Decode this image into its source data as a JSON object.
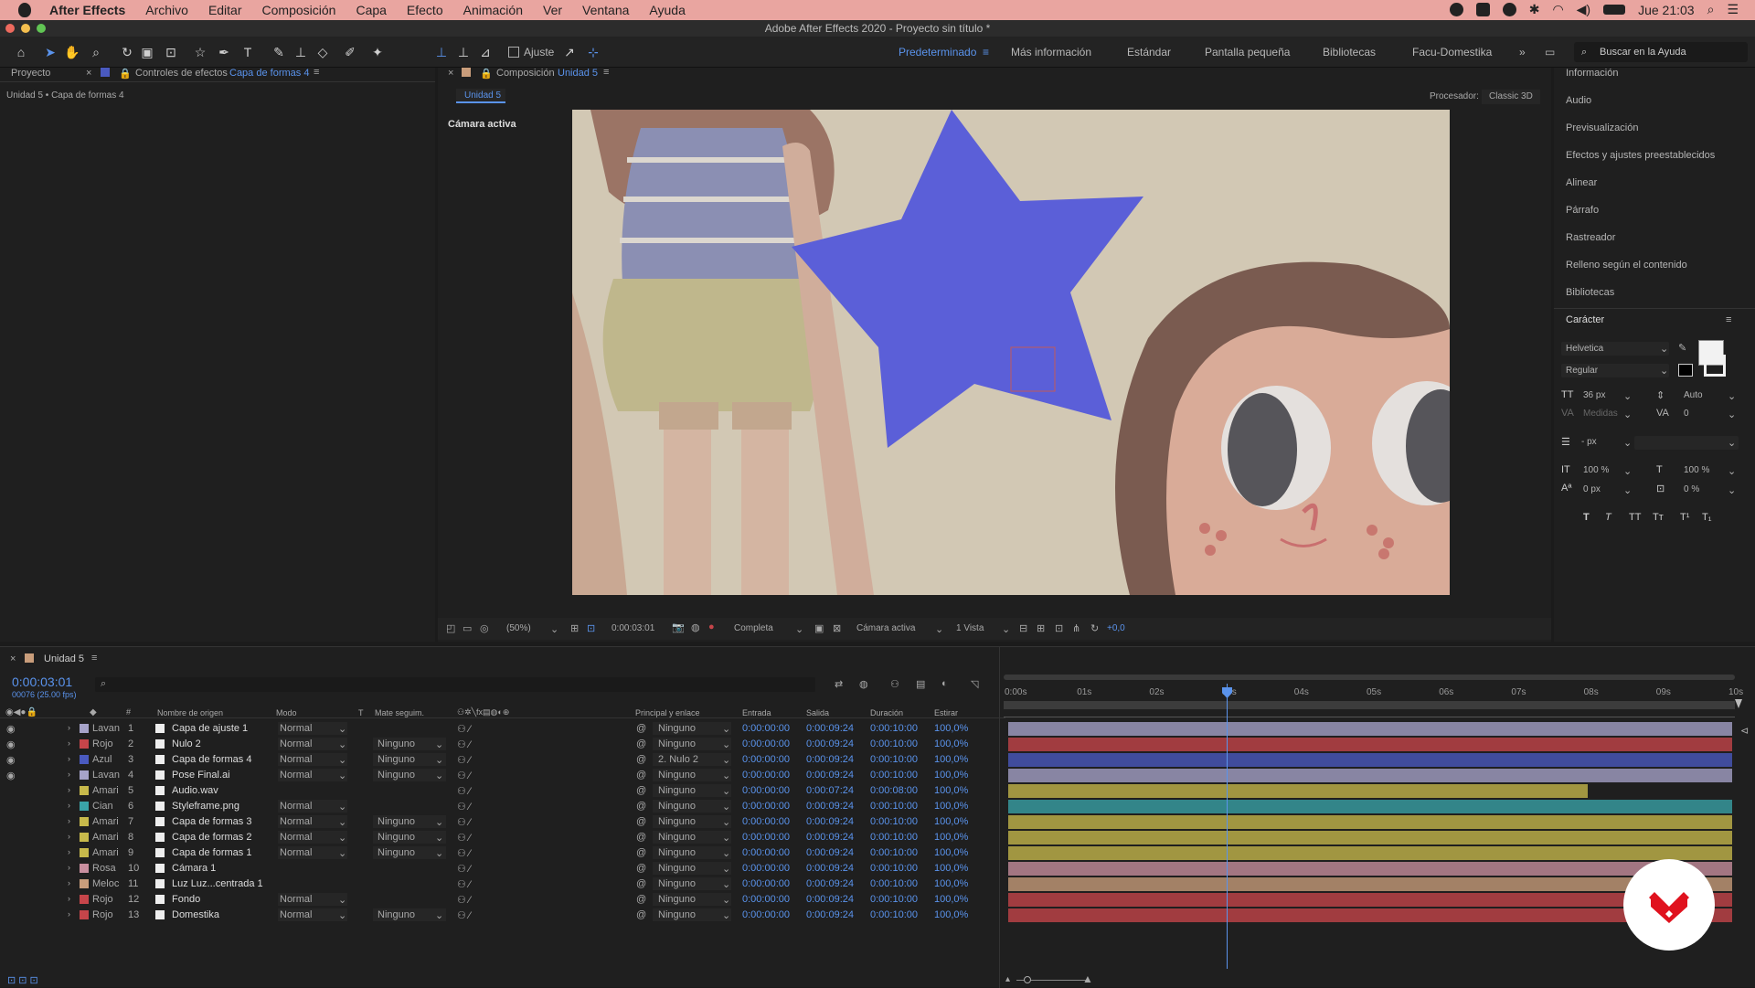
{
  "menubar": {
    "app": "After Effects",
    "items": [
      "Archivo",
      "Editar",
      "Composición",
      "Capa",
      "Efecto",
      "Animación",
      "Ver",
      "Ventana",
      "Ayuda"
    ],
    "clock": "Jue 21:03"
  },
  "window_title": "Adobe After Effects 2020 - Proyecto sin título *",
  "toolbar": {
    "snap": "Ajuste",
    "workspaces": [
      "Predeterminado",
      "Más información",
      "Estándar",
      "Pantalla pequeña",
      "Bibliotecas",
      "Facu-Domestika"
    ],
    "search": "Buscar en la Ayuda"
  },
  "project_panel": {
    "tab_project": "Proyecto",
    "tab_effects": "Controles de efectos",
    "tab_effects_layer": "Capa de formas 4",
    "breadcrumb": "Unidad 5 • Capa de formas 4"
  },
  "comp_panel": {
    "tab": "Composición",
    "tab_comp": "Unidad 5",
    "sub_tab": "Unidad 5",
    "renderer_label": "Procesador:",
    "renderer": "Classic 3D",
    "view_label": "Cámara activa",
    "footer": {
      "zoom": "(50%)",
      "time": "0:00:03:01",
      "quality": "Completa",
      "camera": "Cámara activa",
      "views": "1 Vista",
      "offset": "+0,0"
    }
  },
  "right_panel": {
    "items": [
      "Información",
      "Audio",
      "Previsualización",
      "Efectos y ajustes preestablecidos",
      "Alinear",
      "Párrafo",
      "Rastreador",
      "Relleno según el contenido",
      "Bibliotecas"
    ],
    "character": {
      "title": "Carácter",
      "font": "Helvetica",
      "style": "Regular",
      "size": "36 px",
      "leading": "Auto",
      "kerning": "Medidas",
      "tracking": "0",
      "stroke": "- px",
      "v_scale": "100 %",
      "h_scale": "100 %",
      "baseline": "0 px",
      "tsume": "0 %"
    }
  },
  "timeline": {
    "tab": "Unidad 5",
    "current_time": "0:00:03:01",
    "frame_info": "00076 (25.00 fps)",
    "headers": {
      "source": "Nombre de origen",
      "mode": "Modo",
      "t": "T",
      "matte": "Mate seguim.",
      "parent": "Principal y enlace",
      "in": "Entrada",
      "out": "Salida",
      "duration": "Duración",
      "stretch": "Estirar"
    },
    "ruler": [
      "0:00s",
      "01s",
      "02s",
      "03s",
      "04s",
      "05s",
      "06s",
      "07s",
      "08s",
      "09s",
      "10s"
    ],
    "layers": [
      {
        "label": "Lavan",
        "color": "#a6a3c9",
        "num": "1",
        "name": "Capa de ajuste 1",
        "mode": "Normal",
        "matte": "",
        "parent": "Ninguno",
        "in": "0:00:00:00",
        "out": "0:00:09:24",
        "dur": "0:00:10:00",
        "str": "100,0%"
      },
      {
        "label": "Rojo",
        "color": "#c6454a",
        "num": "2",
        "name": "Nulo 2",
        "mode": "Normal",
        "matte": "Ninguno",
        "parent": "Ninguno",
        "in": "0:00:00:00",
        "out": "0:00:09:24",
        "dur": "0:00:10:00",
        "str": "100,0%"
      },
      {
        "label": "Azul",
        "color": "#4a5ac0",
        "num": "3",
        "name": "Capa de formas 4",
        "mode": "Normal",
        "matte": "Ninguno",
        "parent": "2. Nulo 2",
        "in": "0:00:00:00",
        "out": "0:00:09:24",
        "dur": "0:00:10:00",
        "str": "100,0%"
      },
      {
        "label": "Lavan",
        "color": "#a6a3c9",
        "num": "4",
        "name": "Pose Final.ai",
        "mode": "Normal",
        "matte": "Ninguno",
        "parent": "Ninguno",
        "in": "0:00:00:00",
        "out": "0:00:09:24",
        "dur": "0:00:10:00",
        "str": "100,0%"
      },
      {
        "label": "Amari",
        "color": "#c7b94b",
        "num": "5",
        "name": "Audio.wav",
        "mode": "",
        "matte": "",
        "parent": "Ninguno",
        "in": "0:00:00:00",
        "out": "0:00:07:24",
        "dur": "0:00:08:00",
        "str": "100,0%"
      },
      {
        "label": "Cian",
        "color": "#3aa3a8",
        "num": "6",
        "name": "Styleframe.png",
        "mode": "Normal",
        "matte": "",
        "parent": "Ninguno",
        "in": "0:00:00:00",
        "out": "0:00:09:24",
        "dur": "0:00:10:00",
        "str": "100,0%"
      },
      {
        "label": "Amari",
        "color": "#c7b94b",
        "num": "7",
        "name": "Capa de formas 3",
        "mode": "Normal",
        "matte": "Ninguno",
        "parent": "Ninguno",
        "in": "0:00:00:00",
        "out": "0:00:09:24",
        "dur": "0:00:10:00",
        "str": "100,0%"
      },
      {
        "label": "Amari",
        "color": "#c7b94b",
        "num": "8",
        "name": "Capa de formas 2",
        "mode": "Normal",
        "matte": "Ninguno",
        "parent": "Ninguno",
        "in": "0:00:00:00",
        "out": "0:00:09:24",
        "dur": "0:00:10:00",
        "str": "100,0%"
      },
      {
        "label": "Amari",
        "color": "#c7b94b",
        "num": "9",
        "name": "Capa de formas 1",
        "mode": "Normal",
        "matte": "Ninguno",
        "parent": "Ninguno",
        "in": "0:00:00:00",
        "out": "0:00:09:24",
        "dur": "0:00:10:00",
        "str": "100,0%"
      },
      {
        "label": "Rosa",
        "color": "#c98f9f",
        "num": "10",
        "name": "Cámara 1",
        "mode": "",
        "matte": "",
        "parent": "Ninguno",
        "in": "0:00:00:00",
        "out": "0:00:09:24",
        "dur": "0:00:10:00",
        "str": "100,0%"
      },
      {
        "label": "Meloc",
        "color": "#c99d7b",
        "num": "11",
        "name": "Luz Luz...centrada 1",
        "mode": "",
        "matte": "",
        "parent": "Ninguno",
        "in": "0:00:00:00",
        "out": "0:00:09:24",
        "dur": "0:00:10:00",
        "str": "100,0%"
      },
      {
        "label": "Rojo",
        "color": "#c6454a",
        "num": "12",
        "name": "Fondo",
        "mode": "Normal",
        "matte": "",
        "parent": "Ninguno",
        "in": "0:00:00:00",
        "out": "0:00:09:24",
        "dur": "0:00:10:00",
        "str": "100,0%"
      },
      {
        "label": "Rojo",
        "color": "#c6454a",
        "num": "13",
        "name": "Domestika",
        "mode": "Normal",
        "matte": "Ninguno",
        "parent": "Ninguno",
        "in": "0:00:00:00",
        "out": "0:00:09:24",
        "dur": "0:00:10:00",
        "str": "100,0%"
      }
    ]
  }
}
